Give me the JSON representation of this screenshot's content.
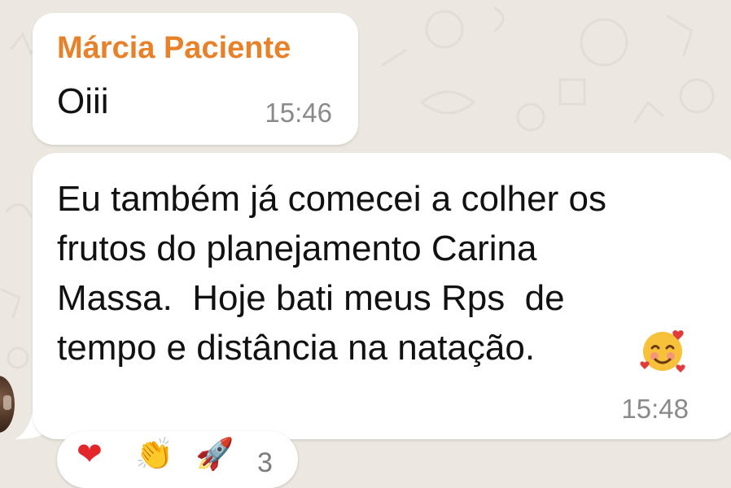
{
  "messages": [
    {
      "sender": "Márcia Paciente",
      "text": "Oiii",
      "time": "15:46"
    },
    {
      "text": "Eu também já comecei a colher os\nfrutos do planejamento Carina\nMassa.  Hoje bati meus Rps  de\ntempo e distância na natação.",
      "emoji": "smiling-face-with-hearts-icon",
      "time": "15:48"
    }
  ],
  "reactions": {
    "items": [
      "❤",
      "👏",
      "🚀"
    ],
    "count": "3"
  },
  "colors": {
    "background": "#ece8e1",
    "bubble": "#ffffff",
    "sender": "#e8822a",
    "time": "#8a8a8a"
  }
}
